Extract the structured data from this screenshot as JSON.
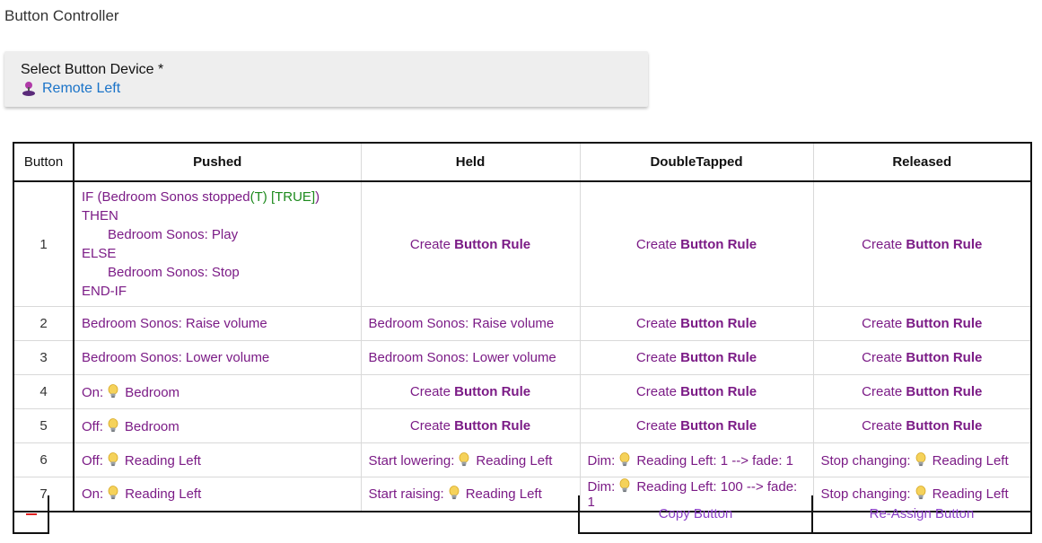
{
  "page": {
    "title": "Button Controller"
  },
  "device": {
    "label": "Select Button Device *",
    "value": "Remote Left",
    "icon": "joystick-icon"
  },
  "table": {
    "headers": [
      "Button",
      "Pushed",
      "Held",
      "DoubleTapped",
      "Released"
    ],
    "create_prefix": "Create",
    "create_bold": "Button Rule",
    "rule1": {
      "if_open": "IF (Bedroom Sonos stopped",
      "if_t": "(T)",
      "if_true": "[TRUE]",
      "if_close": ") THEN",
      "then_action": "Bedroom Sonos: Play",
      "else": "ELSE",
      "else_action": "Bedroom Sonos: Stop",
      "endif": "END-IF"
    },
    "rows": [
      {
        "num": "1"
      },
      {
        "num": "2",
        "pushed": "Bedroom Sonos: Raise volume",
        "held": "Bedroom Sonos: Raise volume"
      },
      {
        "num": "3",
        "pushed": "Bedroom Sonos: Lower volume",
        "held": "Bedroom Sonos: Lower volume"
      },
      {
        "num": "4",
        "pushed_prefix": "On:",
        "pushed_device": "Bedroom"
      },
      {
        "num": "5",
        "pushed_prefix": "Off:",
        "pushed_device": "Bedroom"
      },
      {
        "num": "6",
        "pushed_prefix": "Off:",
        "pushed_device": "Reading Left",
        "held_prefix": "Start lowering:",
        "held_device": "Reading Left",
        "dt_prefix": "Dim:",
        "dt_device": "Reading Left: 1 --> fade: 1",
        "rel_prefix": "Stop changing:",
        "rel_device": "Reading Left"
      },
      {
        "num": "7",
        "pushed_prefix": "On:",
        "pushed_device": "Reading Left",
        "held_prefix": "Start raising:",
        "held_device": "Reading Left",
        "dt_prefix": "Dim:",
        "dt_device": "Reading Left: 100 --> fade: 1",
        "rel_prefix": "Stop changing:",
        "rel_device": "Reading Left"
      }
    ]
  },
  "actions": {
    "remove_icon": "minus-icon",
    "copy": "Copy Button",
    "reassign": "Re-Assign Button"
  },
  "colors": {
    "rule_purple": "#7b1b86",
    "create_green": "#168a16",
    "link_blue": "#1a73c8",
    "action_purple": "#8a3fc7",
    "remove_red": "#e02020"
  }
}
